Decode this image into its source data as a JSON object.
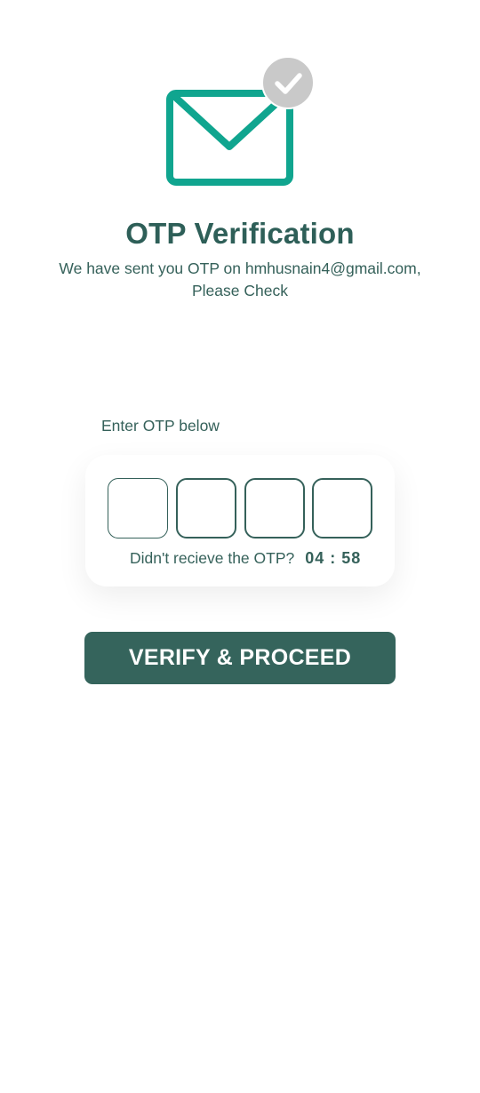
{
  "header": {
    "title": "OTP Verification",
    "subtitle_line1": "We have sent you OTP on hmhusnain4@gmail.com,",
    "subtitle_line2": "Please Check"
  },
  "otp": {
    "label": "Enter OTP below",
    "digits": [
      "",
      "",
      "",
      ""
    ],
    "resend_text": "Didn't recieve the OTP?",
    "timer": "04 : 58"
  },
  "actions": {
    "verify_label": "VERIFY & PROCEED"
  },
  "icons": {
    "envelope": "envelope-icon",
    "check_badge": "check-badge-icon"
  },
  "colors": {
    "accent_teal": "#10a58f",
    "primary_dark_green": "#35645c",
    "badge_gray": "#c9c9c9",
    "text": "#35615a"
  }
}
